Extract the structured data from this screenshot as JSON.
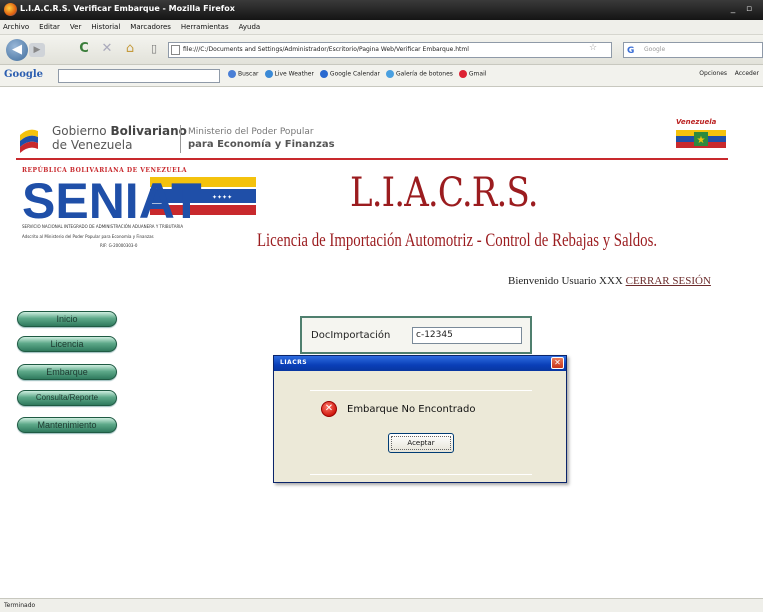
{
  "window": {
    "title": "L.I.A.C.R.S. Verificar Embarque - Mozilla Firefox",
    "minimize": "_",
    "maximize": "▫"
  },
  "menu": [
    "Archivo",
    "Editar",
    "Ver",
    "Historial",
    "Marcadores",
    "Herramientas",
    "Ayuda"
  ],
  "nav": {
    "url": "file:///C:/Documents and Settings/Administrador/Escritorio/Pagina Web/Verificar Embarque.html",
    "search_placeholder": "Google"
  },
  "google_toolbar": {
    "logo": "Google",
    "items": [
      "Buscar",
      "Live Weather",
      "Google Calendar",
      "Galería de botones",
      "Gmail"
    ],
    "right": "Opciones",
    "right2": "Acceder"
  },
  "header": {
    "gov_line1_a": "Gobierno ",
    "gov_line1_b": "Bolivariano",
    "gov_line2": "de Venezuela",
    "ministry1": "Ministerio del Poder Popular",
    "ministry2": "para Economía y Finanzas",
    "venezuela": "Venezuela"
  },
  "seniat": {
    "top": "REPÚBLICA BOLIVARIANA DE VENEZUELA",
    "logo": "SENIAT",
    "line1": "SERVICIO NACIONAL INTEGRADO DE ADMINISTRACIÓN ADUANERA Y TRIBUTARIA",
    "line2": "Adscrito al Ministerio del Poder Popular para Economía y Finanzas",
    "line3": "RIF: G-20000303-0"
  },
  "app": {
    "title": "L.I.A.C.R.S.",
    "subtitle": "Licencia de Importación Automotriz - Control de Rebajas y Saldos."
  },
  "welcome": {
    "text": "Bienvenido Usuario XXX ",
    "logout": "CERRAR SESIÓN"
  },
  "sidebar": [
    "Inicio",
    "Licencia",
    "Embarque",
    "Consulta/Reporte",
    "Mantenimiento"
  ],
  "form": {
    "label": "DocImportación",
    "value": "c-12345"
  },
  "dialog": {
    "title": "LIACRS",
    "close": "✕",
    "message": "Embarque No Encontrado",
    "button": "Aceptar"
  },
  "status": "Terminado"
}
